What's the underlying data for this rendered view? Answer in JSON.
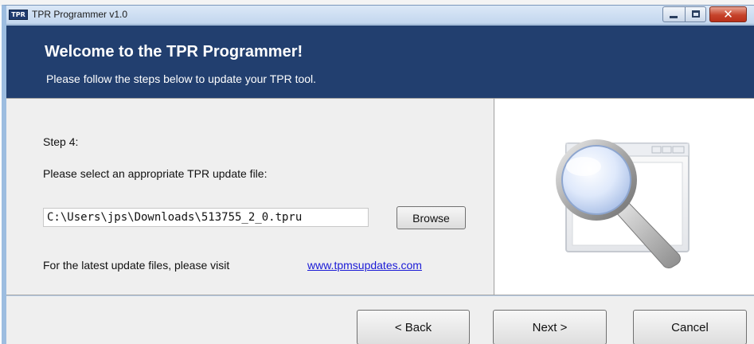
{
  "window": {
    "icon_text": "TPR",
    "title": "TPR Programmer v1.0",
    "close_symbol": "✕"
  },
  "header": {
    "title": "Welcome to the TPR Programmer!",
    "subtitle": "Please follow the steps below to update your TPR tool."
  },
  "content": {
    "step_label": "Step 4:",
    "select_label": "Please select an appropriate TPR update file:",
    "file_path": "C:\\Users\\jps\\Downloads\\513755_2_0.tpru",
    "browse_label": "Browse",
    "visit_text": "For the latest update files, please visit",
    "visit_link": "www.tpmsupdates.com",
    "illustration_icon": "magnifier-over-window-icon"
  },
  "footer": {
    "back_label": "< Back",
    "next_label": "Next >",
    "cancel_label": "Cancel"
  },
  "colors": {
    "header_bg": "#223f6f",
    "link": "#1a1ad6",
    "close_button": "#c6432b"
  }
}
